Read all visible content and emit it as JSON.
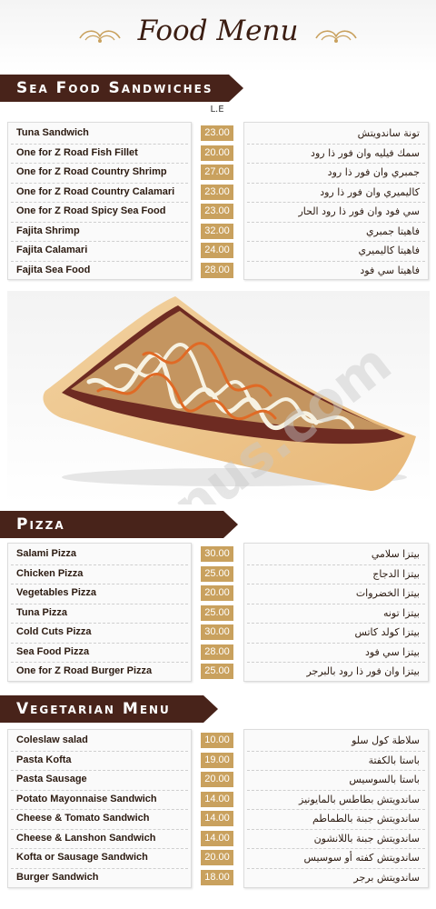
{
  "header": {
    "title": "Food Menu"
  },
  "currency": "L.E",
  "watermark": "elmenus.com ®",
  "sections": [
    {
      "title": "Sea Food Sandwiches",
      "items": [
        {
          "en": "Tuna Sandwich",
          "price": "23.00",
          "ar": "تونة ساندويتش"
        },
        {
          "en": "One for Z Road Fish Fillet",
          "price": "20.00",
          "ar": "سمك فيليه وان فور ذا رود"
        },
        {
          "en": "One for Z Road Country Shrimp",
          "price": "27.00",
          "ar": "جمبري وان فور ذا رود"
        },
        {
          "en": "One for Z Road Country Calamari",
          "price": "23.00",
          "ar": "كاليميري وان فور ذا رود"
        },
        {
          "en": "One for Z Road Spicy Sea Food",
          "price": "23.00",
          "ar": "سي فود وان فور ذا رود الحار"
        },
        {
          "en": "Fajita Shrimp",
          "price": "32.00",
          "ar": "فاهيتا جمبري"
        },
        {
          "en": "Fajita Calamari",
          "price": "24.00",
          "ar": "فاهيتا كاليميري"
        },
        {
          "en": "Fajita Sea Food",
          "price": "28.00",
          "ar": "فاهيتا سي فود"
        }
      ]
    },
    {
      "title": "Pizza",
      "items": [
        {
          "en": "Salami Pizza",
          "price": "30.00",
          "ar": "بيتزا سلامي"
        },
        {
          "en": "Chicken Pizza",
          "price": "25.00",
          "ar": "بيتزا الدجاج"
        },
        {
          "en": "Vegetables Pizza",
          "price": "20.00",
          "ar": "بيتزا الخضروات"
        },
        {
          "en": "Tuna Pizza",
          "price": "25.00",
          "ar": "بيتزا تونه"
        },
        {
          "en": "Cold Cuts Pizza",
          "price": "30.00",
          "ar": "بيتزا كولد كاتس"
        },
        {
          "en": "Sea Food Pizza",
          "price": "28.00",
          "ar": "بيتزا سي فود"
        },
        {
          "en": "One for Z Road Burger Pizza",
          "price": "25.00",
          "ar": "بيتزا وان فور ذا رود بالبرجر"
        }
      ]
    },
    {
      "title": "Vegetarian Menu",
      "items": [
        {
          "en": "Coleslaw salad",
          "price": "10.00",
          "ar": "سلاطة كول سلو"
        },
        {
          "en": "Pasta Kofta",
          "price": "19.00",
          "ar": "باستا بالكفتة"
        },
        {
          "en": "Pasta Sausage",
          "price": "20.00",
          "ar": "باستا بالسوسيس"
        },
        {
          "en": "Potato Mayonnaise Sandwich",
          "price": "14.00",
          "ar": "ساندويتش بطاطس بالمايونيز"
        },
        {
          "en": "Cheese & Tomato Sandwich",
          "price": "14.00",
          "ar": "ساندويتش جبنة بالطماطم"
        },
        {
          "en": "Cheese & Lanshon Sandwich",
          "price": "14.00",
          "ar": "ساندويتش جبنة باللانشون"
        },
        {
          "en": "Kofta or Sausage Sandwich",
          "price": "20.00",
          "ar": "ساندويتش كفته أو سوسيس"
        },
        {
          "en": "Burger Sandwich",
          "price": "18.00",
          "ar": "ساندويتش برجر"
        }
      ]
    }
  ],
  "colors": {
    "banner": "#48231a",
    "price_bg": "#c9a15e",
    "title": "#3b1d12"
  }
}
